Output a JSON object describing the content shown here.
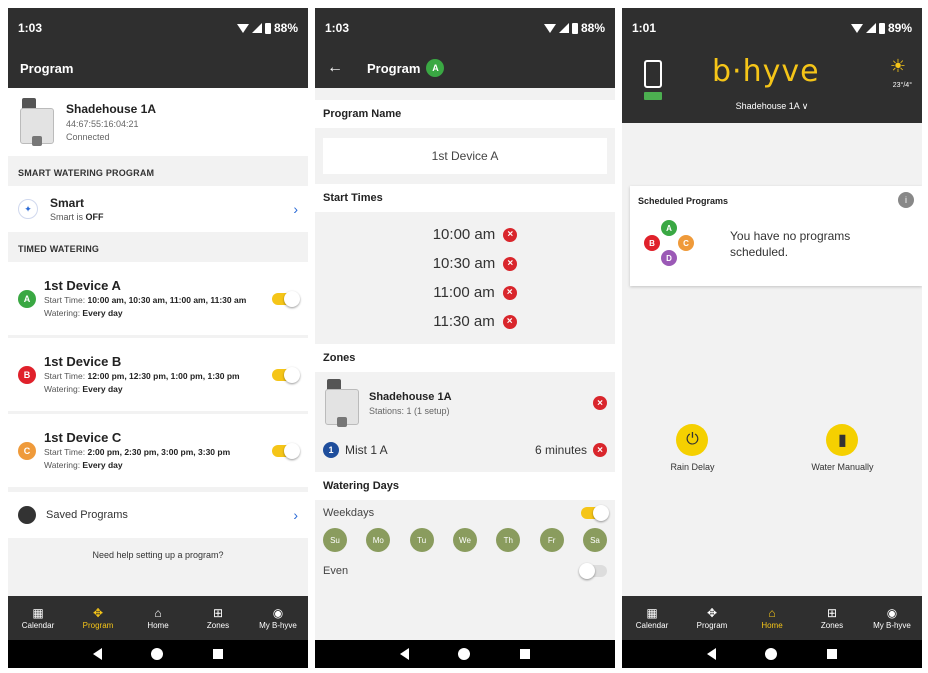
{
  "phone1": {
    "status": {
      "time": "1:03",
      "battery": "88%"
    },
    "appbar_title": "Program",
    "device": {
      "name": "Shadehouse 1A",
      "id": "44:67:55:16:04:21",
      "status": "Connected"
    },
    "smart_section": "SMART WATERING PROGRAM",
    "smart": {
      "title": "Smart",
      "sub_prefix": "Smart is ",
      "sub_value": "OFF"
    },
    "timed_section": "TIMED WATERING",
    "programs": [
      {
        "badge": "A",
        "color": "#3aa843",
        "title": "1st Device A",
        "start_label": "Start Time: ",
        "start_times": "10:00 am, 10:30 am, 11:00 am, 11:30 am",
        "watering_label": "Watering: ",
        "watering": "Every day"
      },
      {
        "badge": "B",
        "color": "#e0212b",
        "title": "1st Device B",
        "start_label": "Start Time: ",
        "start_times": "12:00 pm, 12:30 pm, 1:00 pm, 1:30 pm",
        "watering_label": "Watering: ",
        "watering": "Every day"
      },
      {
        "badge": "C",
        "color": "#ef9a3a",
        "title": "1st  Device C",
        "start_label": "Start Time: ",
        "start_times": "2:00 pm, 2:30 pm, 3:00 pm, 3:30 pm",
        "watering_label": "Watering: ",
        "watering": "Every day"
      }
    ],
    "saved_programs": "Saved Programs",
    "help_text": "Need help setting up a program?"
  },
  "phone2": {
    "status": {
      "time": "1:03",
      "battery": "88%"
    },
    "appbar_title": "Program",
    "appbar_badge": "A",
    "program_name_label": "Program Name",
    "program_name": "1st Device A",
    "start_times_label": "Start Times",
    "start_times": [
      "10:00 am",
      "10:30 am",
      "11:00 am",
      "11:30 am"
    ],
    "zones_label": "Zones",
    "zone_device": {
      "name": "Shadehouse 1A",
      "stations": "Stations: 1 (1 setup)"
    },
    "zone": {
      "num": "1",
      "name": "Mist 1 A",
      "duration": "6 minutes"
    },
    "watering_days_label": "Watering Days",
    "weekdays_label": "Weekdays",
    "days": [
      "Su",
      "Mo",
      "Tu",
      "We",
      "Th",
      "Fr",
      "Sa"
    ],
    "even_label": "Even"
  },
  "phone3": {
    "status": {
      "time": "1:01",
      "battery": "89%"
    },
    "logo": "b·hyve",
    "device_selector": "Shadehouse 1A ∨",
    "temp": "23°/4°",
    "scheduled_title": "Scheduled Programs",
    "info": "i",
    "cluster": [
      "A",
      "B",
      "C",
      "D"
    ],
    "no_programs": "You have no programs scheduled.",
    "rain_delay": "Rain Delay",
    "water_manually": "Water Manually"
  },
  "nav": [
    "Calendar",
    "Program",
    "Home",
    "Zones",
    "My B-hyve"
  ]
}
